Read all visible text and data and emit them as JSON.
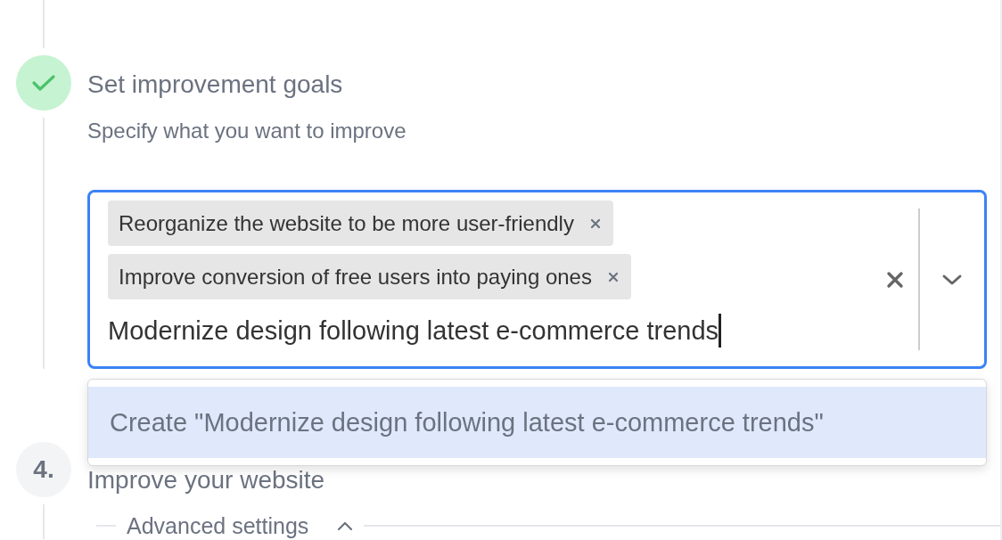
{
  "steps": [
    {
      "kind": "done",
      "title": "Set improvement goals",
      "description": "Specify what you want to improve",
      "select": {
        "focused": true,
        "chips": [
          "Reorganize the website to be more user-friendly",
          "Improve conversion of free users into paying ones"
        ],
        "value": "Modernize design following latest e-commerce trends",
        "menu": {
          "options": [
            {
              "label": "Create \"Modernize design following latest e-commerce trends\"",
              "selected": true
            }
          ]
        }
      }
    },
    {
      "kind": "numbered",
      "number": "4.",
      "title": "Improve your website",
      "advanced": {
        "label": "Advanced settings",
        "expanded": true
      }
    }
  ]
}
